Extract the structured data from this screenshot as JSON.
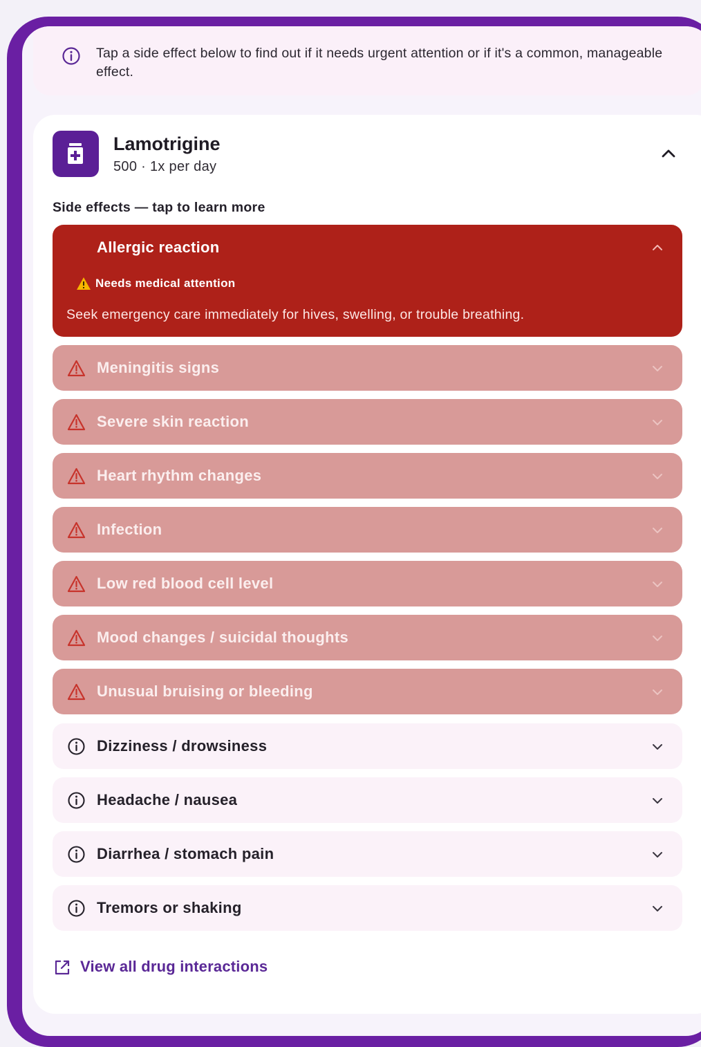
{
  "banner": {
    "text": "Tap a side effect below to find out if it needs urgent attention or if it's a common, manageable effect.",
    "icon": "info-icon"
  },
  "medication": {
    "name": "Lamotrigine",
    "dose": "500 · 1x per day",
    "icon": "medicine-bottle-icon"
  },
  "side_effects_label": "Side effects — tap to learn more",
  "expanded_effect": {
    "label": "Allergic reaction",
    "badge": "Needs medical attention",
    "description": "Seek emergency care immediately for hives, swelling, or trouble breathing."
  },
  "severe_effects": [
    {
      "label": "Meningitis signs"
    },
    {
      "label": "Severe skin reaction"
    },
    {
      "label": "Heart rhythm changes"
    },
    {
      "label": "Infection"
    },
    {
      "label": "Low red blood cell level"
    },
    {
      "label": "Mood changes / suicidal thoughts"
    },
    {
      "label": "Unusual bruising or bleeding"
    }
  ],
  "common_effects": [
    {
      "label": "Dizziness / drowsiness"
    },
    {
      "label": "Headache / nausea"
    },
    {
      "label": "Diarrhea / stomach pain"
    },
    {
      "label": "Tremors or shaking"
    }
  ],
  "link": {
    "text": "View all drug interactions",
    "icon": "external-link-icon"
  },
  "colors": {
    "frame": "#6a1fa3",
    "severe_expanded": "#ae2119",
    "severe_row": "#d89a98",
    "common_row": "#fbf2f9",
    "accent": "#5b1f96"
  }
}
